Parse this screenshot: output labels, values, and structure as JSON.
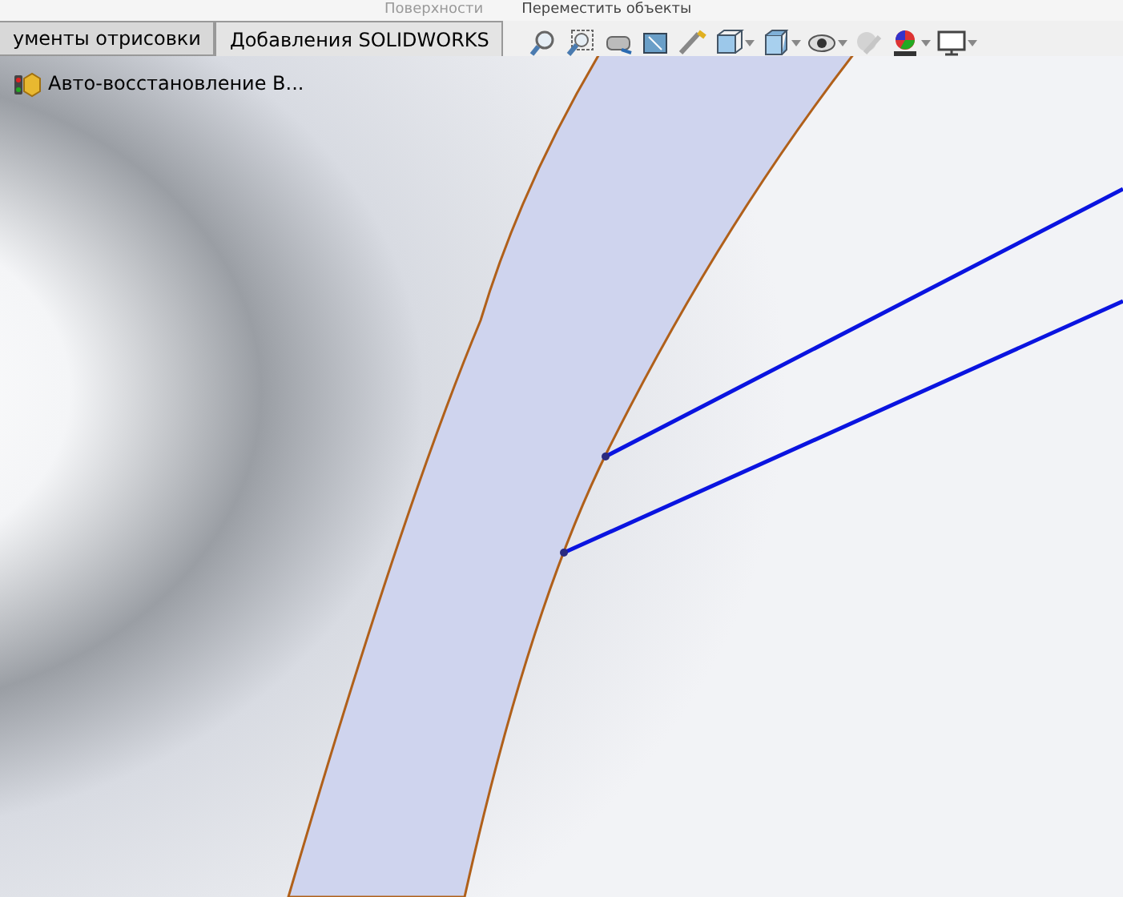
{
  "ribbon": {
    "labels": [
      "Поверхности",
      "Переместить объекты"
    ]
  },
  "tabs": [
    {
      "label": "ументы отрисовки",
      "selected": false
    },
    {
      "label": "Добавления SOLIDWORKS",
      "selected": true
    }
  ],
  "tree": {
    "items": [
      {
        "label": "Авто-восстановление В..."
      }
    ]
  },
  "toolbar": {
    "icons": [
      {
        "kind": "zoom-fit"
      },
      {
        "kind": "zoom-area"
      },
      {
        "kind": "previous-view"
      },
      {
        "kind": "section"
      },
      {
        "kind": "dynamic"
      },
      {
        "kind": "view-orientation",
        "dropdown": true
      },
      {
        "kind": "display-style",
        "dropdown": true
      },
      {
        "kind": "hide-show",
        "dropdown": true
      },
      {
        "kind": "edit-appearance"
      },
      {
        "kind": "scene",
        "dropdown": true
      },
      {
        "kind": "display",
        "dropdown": true
      }
    ]
  }
}
